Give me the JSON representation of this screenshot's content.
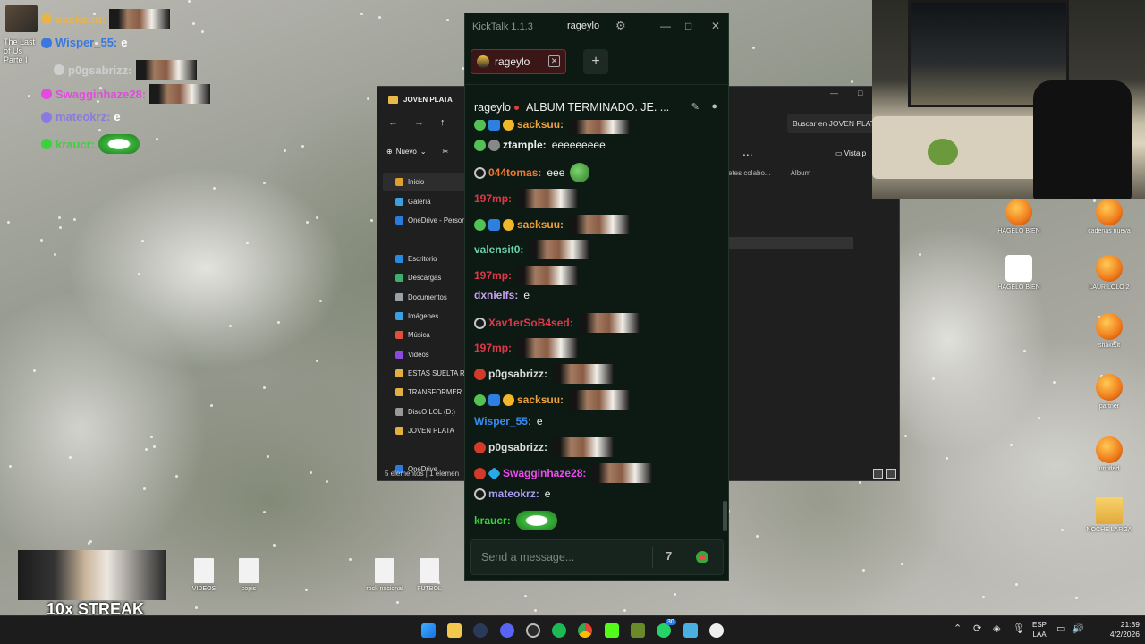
{
  "overlay": {
    "game_label": "The Last of Us Parte I",
    "lines": [
      {
        "user": "sacksuu:",
        "color": "#e8b44a",
        "text": ""
      },
      {
        "user": "Wisper_55:",
        "color": "#3a78e0",
        "text": "e"
      },
      {
        "user": "p0gsabrizz:",
        "color": "#cfcfcf",
        "text": ""
      },
      {
        "user": "Swagginhaze28:",
        "color": "#e24ae0",
        "text": ""
      },
      {
        "user": "mateokrz:",
        "color": "#8a7ae0",
        "text": "e"
      },
      {
        "user": "kraucr:",
        "color": "#3ad13a",
        "text": ""
      }
    ]
  },
  "explorer": {
    "title": "JOVEN PLATA",
    "search": "Buscar en JOVEN PLATA",
    "new_label": "Nuevo",
    "view_label": "Vista p",
    "more": "...",
    "columns": [
      "etes colabo...",
      "Álbum"
    ],
    "sidebar": [
      {
        "label": "Inicio",
        "color": "#e0a030"
      },
      {
        "label": "Galería",
        "color": "#3aa0e0"
      },
      {
        "label": "OneDrive - Persona",
        "color": "#2a7ae0"
      },
      {
        "label": "",
        "color": "transparent"
      },
      {
        "label": "Escritorio",
        "color": "#2a8ae0"
      },
      {
        "label": "Descargas",
        "color": "#3ab06a"
      },
      {
        "label": "Documentos",
        "color": "#9aa0a8"
      },
      {
        "label": "Imágenes",
        "color": "#3aa0e0"
      },
      {
        "label": "Música",
        "color": "#e0503a"
      },
      {
        "label": "Videos",
        "color": "#8a4ae0"
      },
      {
        "label": "ESTAS SUELTA RU",
        "color": "#e0b040"
      },
      {
        "label": "TRANSFORMER",
        "color": "#e0b040"
      },
      {
        "label": "DiscO LOL (D:)",
        "color": "#999999"
      },
      {
        "label": "JOVEN PLATA",
        "color": "#e0b040"
      },
      {
        "label": "",
        "color": "transparent"
      },
      {
        "label": "OneDrive",
        "color": "#2a7ae0"
      }
    ],
    "status": "5 elementos  |  1 elemen"
  },
  "kicktalk": {
    "app_title": "KickTalk 1.1.3",
    "user": "rageylo",
    "tab_label": "rageylo",
    "channel": "rageylo",
    "stream_title": "ALBUM TERMINADO. JE. ...",
    "input_placeholder": "Send a message...",
    "messages": [
      {
        "user": "sacksuu:",
        "color": "#f0a23a",
        "badges": [
          "b-green",
          "b-blue",
          "b-gold"
        ],
        "text": "",
        "emote": "face"
      },
      {
        "user": "ztample:",
        "color": "#eeeeee",
        "badges": [
          "b-green",
          "b-gray"
        ],
        "text": "eeeeeeeee",
        "emote": ""
      },
      {
        "user": "044tomas:",
        "color": "#f07a30",
        "badges": [
          "b-ring"
        ],
        "text": "eee",
        "emote": "pepe"
      },
      {
        "user": "197mp:",
        "color": "#e0384a",
        "badges": [],
        "text": "",
        "emote": "face"
      },
      {
        "user": "sacksuu:",
        "color": "#f0a23a",
        "badges": [
          "b-green",
          "b-blue",
          "b-gold"
        ],
        "text": "",
        "emote": "face"
      },
      {
        "user": "valensit0:",
        "color": "#6ad0b0",
        "badges": [],
        "text": "",
        "emote": "face"
      },
      {
        "user": "197mp:",
        "color": "#e0384a",
        "badges": [],
        "text": "",
        "emote": "face"
      },
      {
        "user": "dxnielfs:",
        "color": "#c7a0f0",
        "badges": [],
        "text": "e",
        "emote": ""
      },
      {
        "user": "Xav1erSoB4sed:",
        "color": "#e0384a",
        "badges": [
          "b-ring"
        ],
        "text": "",
        "emote": "face"
      },
      {
        "user": "197mp:",
        "color": "#e0384a",
        "badges": [],
        "text": "",
        "emote": "face"
      },
      {
        "user": "p0gsabrizz:",
        "color": "#dcdcdc",
        "badges": [
          "b-red"
        ],
        "text": "",
        "emote": "face"
      },
      {
        "user": "sacksuu:",
        "color": "#f0a23a",
        "badges": [
          "b-green",
          "b-blue",
          "b-gold"
        ],
        "text": "",
        "emote": "face"
      },
      {
        "user": "Wisper_55:",
        "color": "#3a8af0",
        "badges": [],
        "text": "e",
        "emote": ""
      },
      {
        "user": "p0gsabrizz:",
        "color": "#dcdcdc",
        "badges": [
          "b-red"
        ],
        "text": "",
        "emote": "face"
      },
      {
        "user": "Swagginhaze28:",
        "color": "#f04af0",
        "badges": [
          "b-red",
          "b-cube"
        ],
        "text": "",
        "emote": "face"
      },
      {
        "user": "mateokrz:",
        "color": "#a89af0",
        "badges": [
          "b-ring"
        ],
        "text": "e",
        "emote": ""
      },
      {
        "user": "kraucr:",
        "color": "#3ad13a",
        "badges": [],
        "text": "",
        "emote": "grin"
      }
    ]
  },
  "desktop_icons": [
    {
      "label": "HAGELO BIEN",
      "kind": "g"
    },
    {
      "label": "cadenas nueva",
      "kind": "g"
    },
    {
      "label": "HAGELO BIEN",
      "kind": "play"
    },
    {
      "label": "LAURILOLO 2",
      "kind": "g"
    },
    {
      "label": "snake.it",
      "kind": "g"
    },
    {
      "label": "partner",
      "kind": "g"
    },
    {
      "label": "untitled",
      "kind": "g"
    },
    {
      "label": "NOCHE LARGA",
      "kind": "folder"
    }
  ],
  "bottom_files": [
    {
      "label": "VIDEOS"
    },
    {
      "label": "copis"
    },
    {
      "label": "rock nacional"
    },
    {
      "label": "FUTBOL"
    }
  ],
  "facecam": {
    "streak": "10x STREAK"
  },
  "taskbar": {
    "lang_top": "ESP",
    "lang_bottom": "LAA",
    "time": "21:39",
    "date": "4/2/2026",
    "badge_count": "30"
  }
}
